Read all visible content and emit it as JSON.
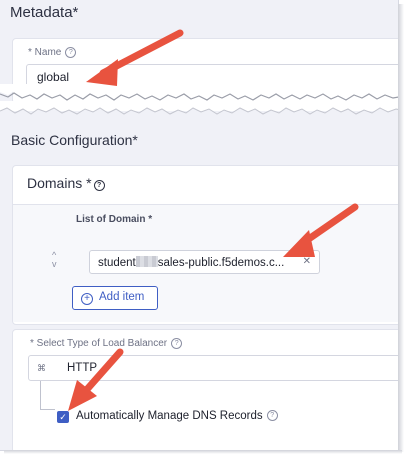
{
  "metadata": {
    "heading": "Metadata*",
    "name_label": "* Name",
    "name_value": "global"
  },
  "basic": {
    "heading": "Basic Configuration*"
  },
  "domains": {
    "heading": "Domains *",
    "list_label": "List of Domain *",
    "item_prefix": "student",
    "item_suffix": "sales-public.f5demos.c...",
    "add_label": "Add item"
  },
  "load_balancer": {
    "label": "* Select Type of Load Balancer",
    "value": "HTTP",
    "dns_label": "Automatically Manage DNS Records",
    "dns_checked": true
  },
  "colors": {
    "annotation_arrow": "#e8533f",
    "accent": "#3f5ec4"
  }
}
